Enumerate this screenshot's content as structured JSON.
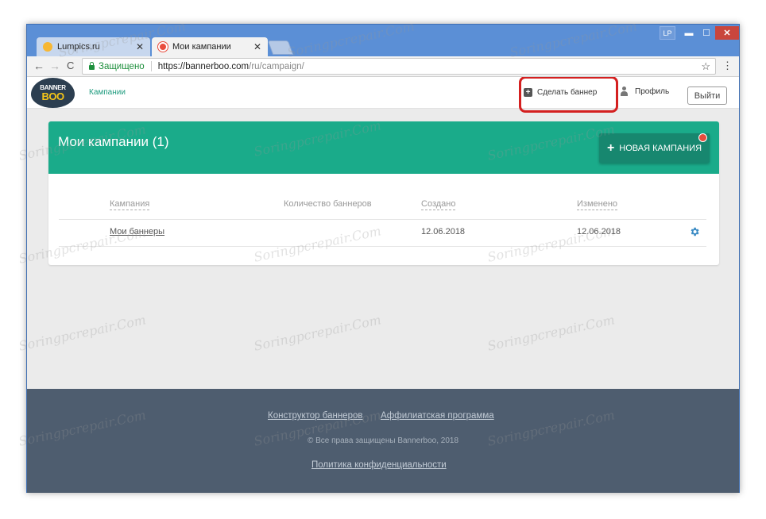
{
  "browser": {
    "tabs": [
      {
        "label": "Lumpics.ru",
        "close": "✕"
      },
      {
        "label": "Мои кампании",
        "close": "✕"
      }
    ],
    "user_badge": "LP",
    "window_controls": {
      "minimize": "▬",
      "maximize": "☐",
      "close": "✕"
    },
    "nav": {
      "back": "←",
      "forward": "→",
      "reload": "C"
    },
    "secure_label": "Защищено",
    "url_main": "https://bannerboo.com",
    "url_path": "/ru/campaign/",
    "bookmark_icon": "☆",
    "menu_icon": "⋮"
  },
  "site": {
    "logo_line1": "BANNER",
    "logo_line2": "BOO",
    "nav_campaigns": "Кампании",
    "make_banner": "Сделать баннер",
    "make_banner_icon": "+",
    "profile": "Профиль",
    "logout": "Выйти"
  },
  "card": {
    "title": "Мои кампании (1)",
    "new_campaign": "НОВАЯ КАМПАНИЯ",
    "new_campaign_icon": "+",
    "columns": [
      "Кампания",
      "Количество баннеров",
      "Создано",
      "Изменено"
    ],
    "rows": [
      {
        "name": "Мои баннеры",
        "count": "",
        "created": "12.06.2018",
        "modified": "12.06.2018"
      }
    ]
  },
  "footer": {
    "link_constructor": "Конструктор баннеров",
    "link_affiliate": "Аффилиатская программа",
    "copyright": "© Все права защищены Bannerboo, 2018",
    "privacy": "Политика конфиденциальности"
  },
  "watermark": "Soringpcrepair.Com",
  "colors": {
    "accent": "#1aab8a",
    "accent_dark": "#17876f",
    "highlight": "#d42020",
    "footer": "#4e5d6f",
    "window_frame": "#5b8fd6"
  }
}
